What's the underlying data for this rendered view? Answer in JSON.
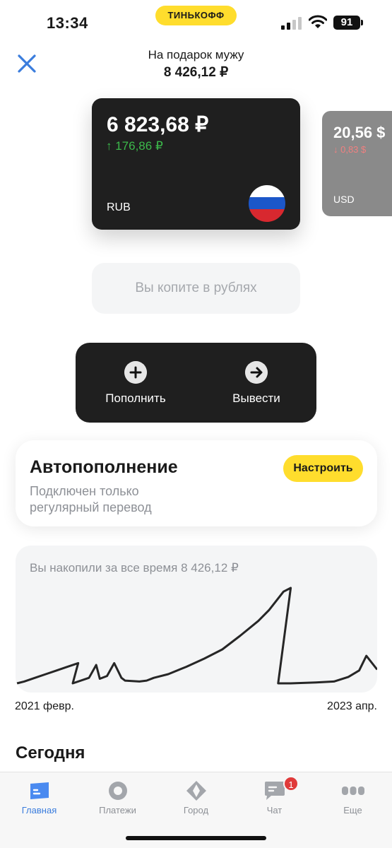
{
  "status_bar": {
    "time": "13:34",
    "brand": "ТИНЬКОФФ",
    "battery": "91",
    "icons": [
      "signal-icon",
      "wifi-icon",
      "battery-icon"
    ]
  },
  "header": {
    "title": "На подарок мужу",
    "amount": "8 426,12 ₽",
    "close_icon": "close-icon"
  },
  "cards": [
    {
      "amount": "6 823,68 ₽",
      "delta": "↑ 176,86 ₽",
      "currency": "RUB",
      "flag_icon": "russia-flag-icon"
    },
    {
      "amount": "20,56 $",
      "delta": "↓ 0,83 $",
      "currency": "USD"
    }
  ],
  "saving_note": "Вы копите в рублях",
  "actions": {
    "topup_label": "Пополнить",
    "withdraw_label": "Вывести",
    "topup_icon": "plus-icon",
    "withdraw_icon": "arrow-right-icon"
  },
  "autofill": {
    "title": "Автопополнение",
    "description": "Подключен только регулярный перевод",
    "button": "Настроить"
  },
  "chart": {
    "caption": "Вы накопили за все время 8 426,12 ₽",
    "x_start": "2021 февр.",
    "x_end": "2023 апр."
  },
  "chart_data": {
    "type": "line",
    "title": "Вы накопили за все время 8 426,12 ₽",
    "xlabel": "",
    "ylabel": "",
    "x_range": [
      "2021 февр.",
      "2023 апр."
    ],
    "grid": false,
    "series": [
      {
        "name": "",
        "x": [
          0,
          0.02,
          0.05,
          0.08,
          0.11,
          0.14,
          0.17,
          0.155,
          0.2,
          0.22,
          0.23,
          0.25,
          0.27,
          0.29,
          0.3,
          0.34,
          0.36,
          0.38,
          0.42,
          0.47,
          0.52,
          0.57,
          0.62,
          0.67,
          0.7,
          0.72,
          0.74,
          0.76,
          0.725,
          0.76,
          0.83,
          0.88,
          0.92,
          0.95,
          0.97,
          1.0
        ],
        "values": [
          0.0,
          0.02,
          0.06,
          0.1,
          0.14,
          0.18,
          0.22,
          0.0,
          0.06,
          0.2,
          0.05,
          0.08,
          0.22,
          0.06,
          0.03,
          0.02,
          0.03,
          0.06,
          0.1,
          0.18,
          0.27,
          0.37,
          0.52,
          0.68,
          0.8,
          0.9,
          1.0,
          1.04,
          0.0,
          0.0,
          0.01,
          0.02,
          0.07,
          0.14,
          0.3,
          0.15
        ]
      }
    ]
  },
  "section_title": "Сегодня",
  "tab_bar": {
    "items": [
      {
        "label": "Главная",
        "icon": "home-card-icon",
        "active": true
      },
      {
        "label": "Платежи",
        "icon": "payments-circle-icon",
        "active": false
      },
      {
        "label": "Город",
        "icon": "city-diamond-icon",
        "active": false
      },
      {
        "label": "Чат",
        "icon": "chat-bubble-icon",
        "active": false,
        "badge": "1"
      },
      {
        "label": "Еще",
        "icon": "more-dots-icon",
        "active": false
      }
    ]
  },
  "colors": {
    "accent_yellow": "#ffdd2d",
    "dark_card": "#1f1f1f",
    "positive": "#3cb94b",
    "negative": "#f08080",
    "tab_active": "#3b7ddd"
  }
}
